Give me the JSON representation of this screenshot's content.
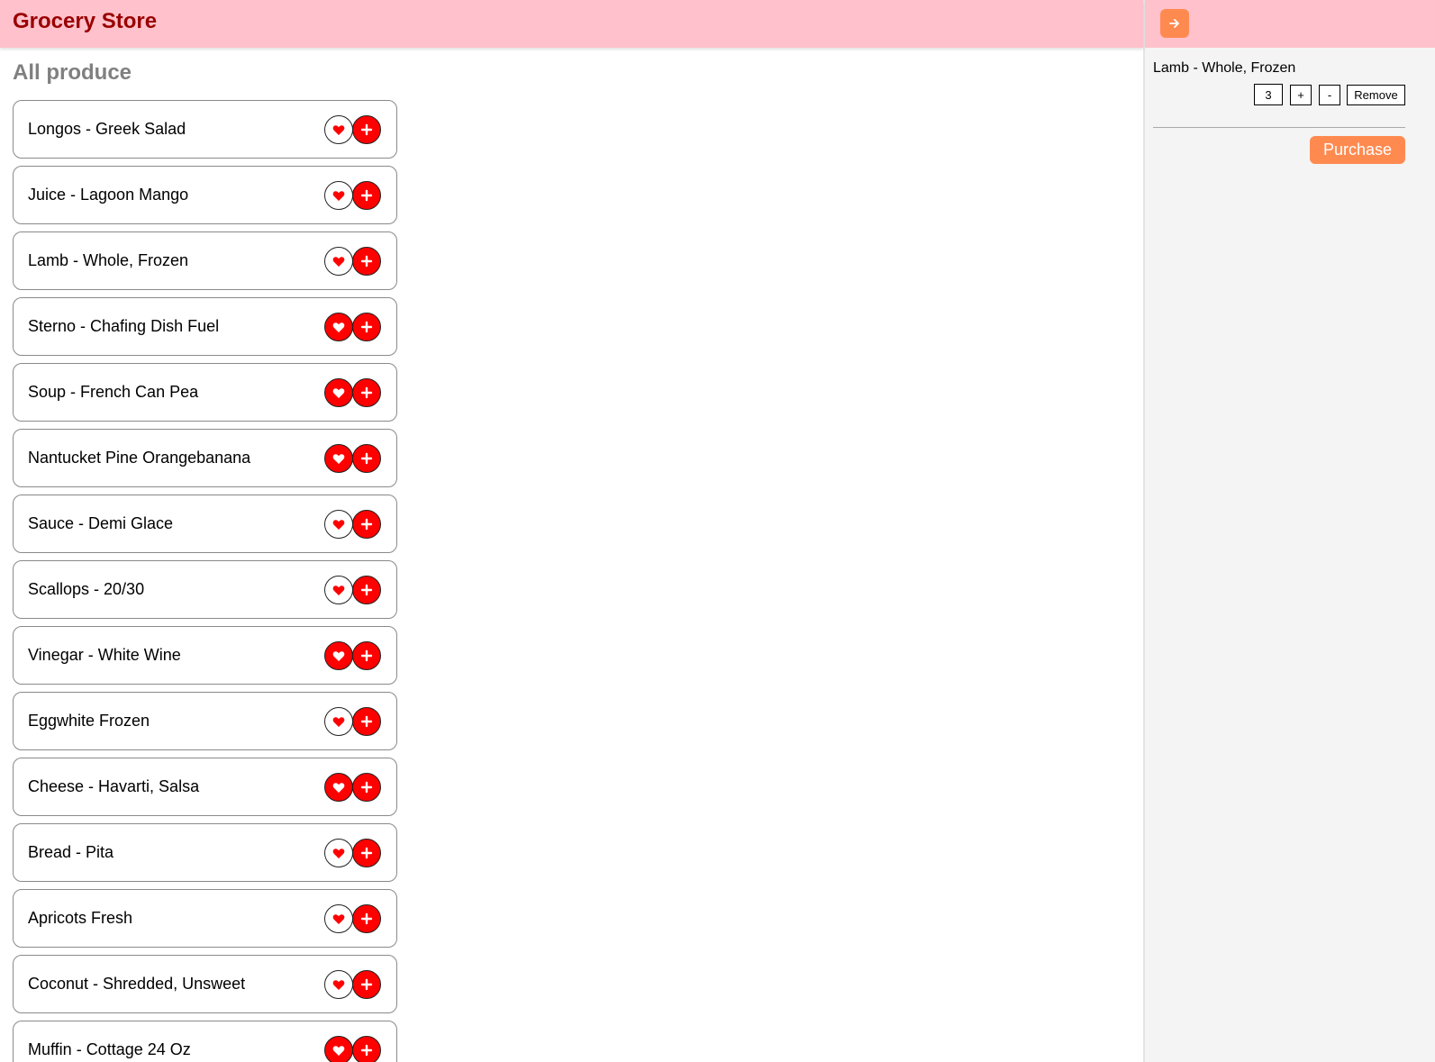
{
  "header": {
    "title": "Grocery Store"
  },
  "main": {
    "section_title": "All produce",
    "products": [
      {
        "name": "Longos - Greek Salad",
        "favorite": false
      },
      {
        "name": "Juice - Lagoon Mango",
        "favorite": false
      },
      {
        "name": "Lamb - Whole, Frozen",
        "favorite": false
      },
      {
        "name": "Sterno - Chafing Dish Fuel",
        "favorite": true
      },
      {
        "name": "Soup - French Can Pea",
        "favorite": true
      },
      {
        "name": "Nantucket Pine Orangebanana",
        "favorite": true
      },
      {
        "name": "Sauce - Demi Glace",
        "favorite": false
      },
      {
        "name": "Scallops - 20/30",
        "favorite": false
      },
      {
        "name": "Vinegar - White Wine",
        "favorite": true
      },
      {
        "name": "Eggwhite Frozen",
        "favorite": false
      },
      {
        "name": "Cheese - Havarti, Salsa",
        "favorite": true
      },
      {
        "name": "Bread - Pita",
        "favorite": false
      },
      {
        "name": "Apricots Fresh",
        "favorite": false
      },
      {
        "name": "Coconut - Shredded, Unsweet",
        "favorite": false
      },
      {
        "name": "Muffin - Cottage 24 Oz",
        "favorite": true
      }
    ]
  },
  "cart": {
    "toggle_icon": "arrow-right-icon",
    "items": [
      {
        "name": "Lamb - Whole, Frozen",
        "quantity": "3"
      }
    ],
    "increment_label": "+",
    "decrement_label": "-",
    "remove_label": "Remove",
    "purchase_label": "Purchase"
  },
  "colors": {
    "header_bg": "#ffc1cc",
    "title_color": "#990000",
    "accent_red": "#ff0000",
    "accent_orange": "#ff8a50",
    "sidebar_bg": "#f4f4f4"
  }
}
